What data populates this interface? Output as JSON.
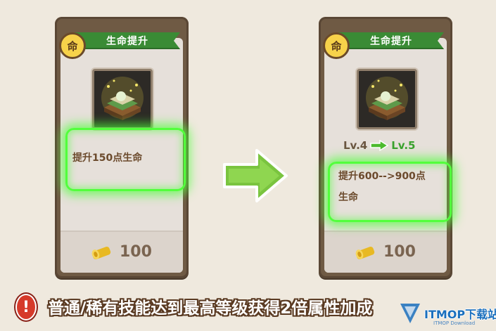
{
  "left_card": {
    "badge": "命",
    "title": "生命提升",
    "description": "提升150点生命",
    "price": "100",
    "icon": "skill-book-icon"
  },
  "right_card": {
    "badge": "命",
    "title": "生命提升",
    "level_from": "Lv.4",
    "level_to": "Lv.5",
    "description_line1": "提升600-->900点",
    "description_line2": "生命",
    "price": "100",
    "icon": "skill-book-icon"
  },
  "notice": {
    "text": "普通/稀有技能达到最高等级获得2倍属性加成",
    "icon": "exclamation-icon"
  },
  "watermark": {
    "text": "ITMOP下载站",
    "sub": "ITMOP Download"
  },
  "colors": {
    "glow": "#52ff3c",
    "ribbon": "#3a8b35",
    "card_frame": "#6f5a44",
    "price": "#7a6450"
  }
}
